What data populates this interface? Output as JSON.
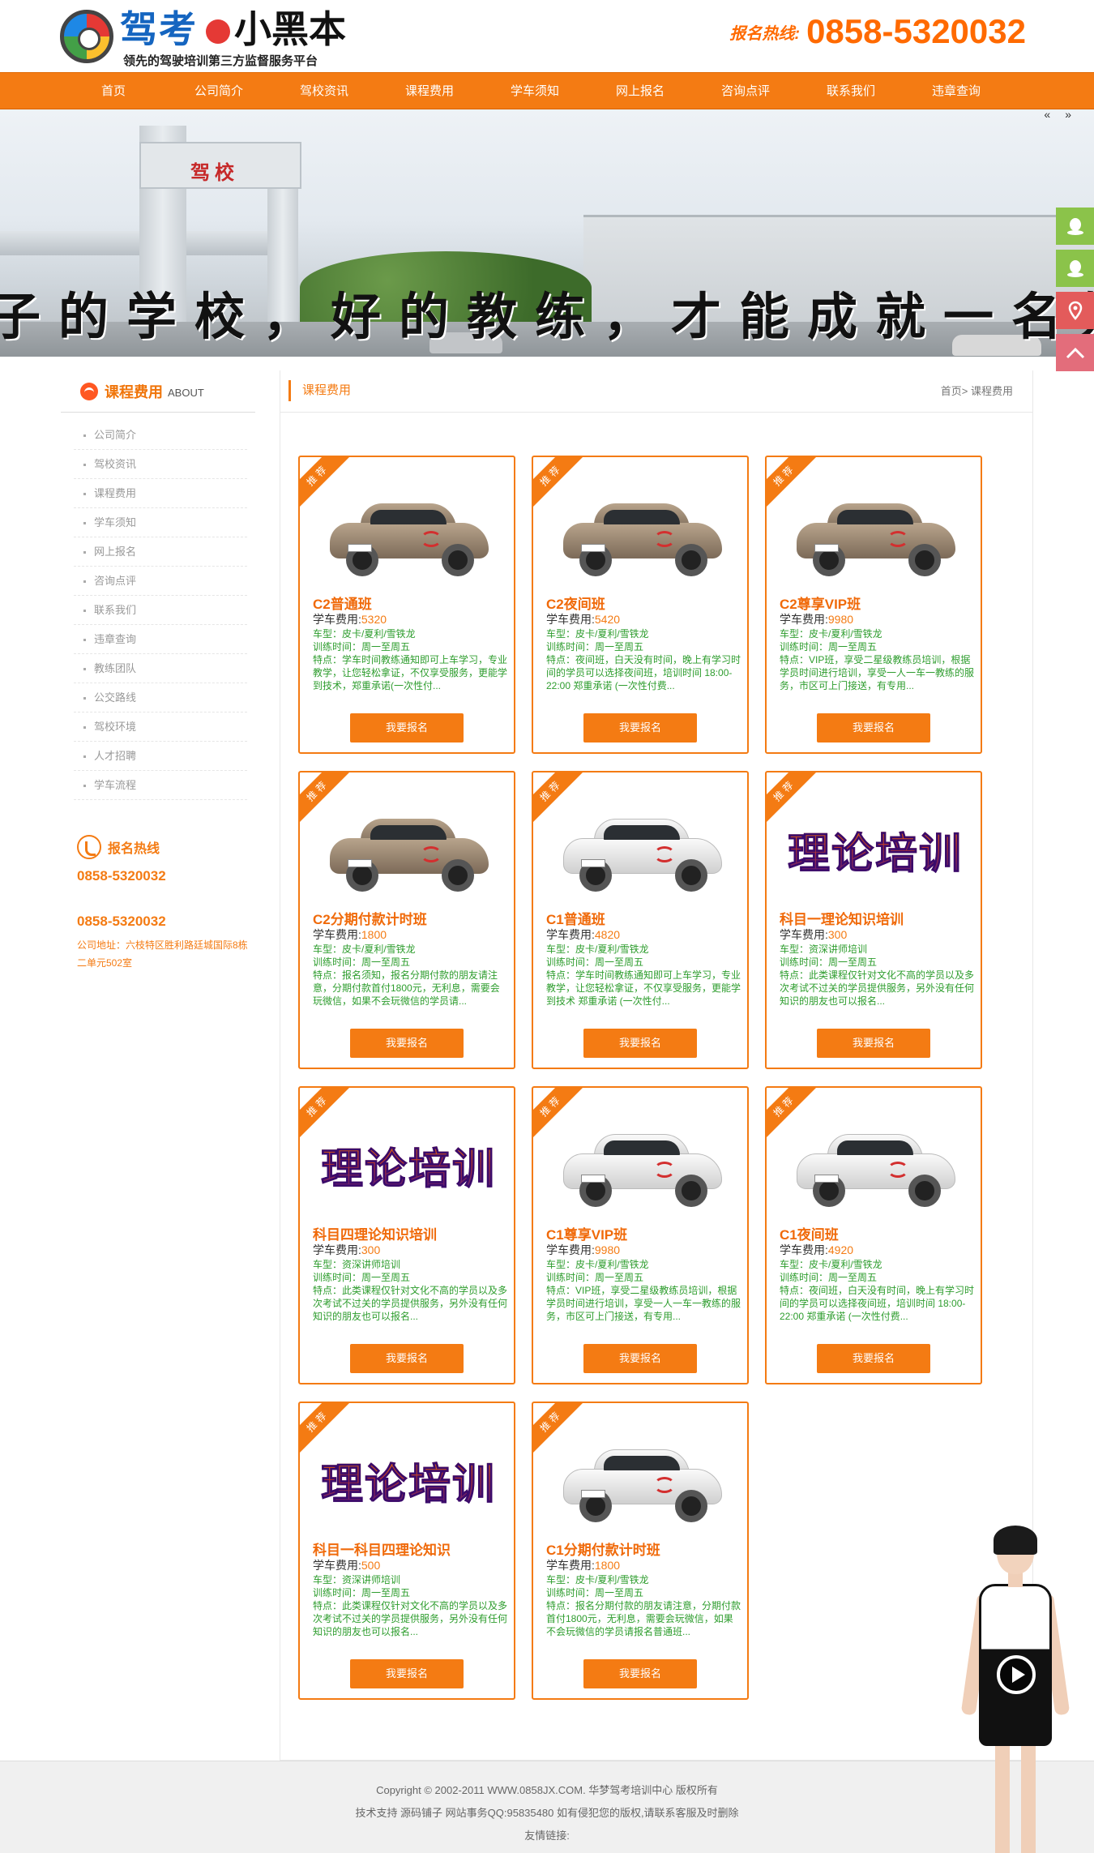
{
  "header": {
    "logo_text_1": "驾考",
    "logo_text_2": "小黑本",
    "logo_slogan": "领先的驾驶培训第三方监督服务平台",
    "hotline_label": "报名热线:",
    "hotline_number": "0858-5320032"
  },
  "nav": [
    "首页",
    "公司简介",
    "驾校资讯",
    "课程费用",
    "学车须知",
    "网上报名",
    "咨询点评",
    "联系我们",
    "违章查询"
  ],
  "banner": {
    "gate_sign": "驾校",
    "slogan": "子的学校，好的教练，才能成就一名好的司"
  },
  "sidebar": {
    "title": "课程费用",
    "title_sub": "ABOUT",
    "items": [
      "公司简介",
      "驾校资讯",
      "课程费用",
      "学车须知",
      "网上报名",
      "咨询点评",
      "联系我们",
      "违章查询",
      "教练团队",
      "公交路线",
      "驾校环境",
      "人才招聘",
      "学车流程"
    ],
    "contact_title": "报名热线",
    "phone_1": "0858-5320032",
    "phone_2": "0858-5320032",
    "address": "公司地址：六枝特区胜利路廷城国际8栋二单元502室"
  },
  "content": {
    "title": "课程费用",
    "breadcrumb": "首页> 课程费用"
  },
  "ribbon_label": "推荐",
  "fee_label": "学车费用:",
  "signup_label": "我要报名",
  "courses": [
    {
      "name": "C2普通班",
      "fee": "5320",
      "image": "brown-car",
      "car": "车型：皮卡/夏利/雪铁龙",
      "time": "训练时间：周一至周五",
      "desc": "特点：学车时间教练通知即可上车学习，专业教学，让您轻松拿证，不仅享受服务，更能学到技术，郑重承诺(一次性付..."
    },
    {
      "name": "C2夜间班",
      "fee": "5420",
      "image": "brown-car",
      "car": "车型：皮卡/夏利/雪铁龙",
      "time": "训练时间：周一至周五",
      "desc": "特点：夜间班，白天没有时间，晚上有学习时间的学员可以选择夜间班，培训时间 18:00-22:00 郑重承诺 (一次性付费..."
    },
    {
      "name": "C2尊享VIP班",
      "fee": "9980",
      "image": "brown-car",
      "car": "车型：皮卡/夏利/雪铁龙",
      "time": "训练时间：周一至周五",
      "desc": "特点：VIP班，享受二星级教练员培训，根据学员时间进行培训，享受一人一车一教练的服务，市区可上门接送，有专用..."
    },
    {
      "name": "C2分期付款计时班",
      "fee": "1800",
      "image": "brown-car",
      "car": "车型：皮卡/夏利/雪铁龙",
      "time": "训练时间：周一至周五",
      "desc": "特点：报名须知，报名分期付款的朋友请注意，分期付款首付1800元，无利息，需要会玩微信，如果不会玩微信的学员请..."
    },
    {
      "name": "C1普通班",
      "fee": "4820",
      "image": "white-car",
      "car": "车型：皮卡/夏利/雪铁龙",
      "time": "训练时间：周一至周五",
      "desc": "特点：学车时间教练通知即可上车学习，专业教学，让您轻松拿证，不仅享受服务，更能学到技术 郑重承诺 (一次性付..."
    },
    {
      "name": "科目一理论知识培训",
      "fee": "300",
      "image": "theory",
      "car": "车型：资深讲师培训",
      "time": "训练时间：周一至周五",
      "desc": "特点：此类课程仅针对文化不高的学员以及多次考试不过关的学员提供服务，另外没有任何知识的朋友也可以报名..."
    },
    {
      "name": "科目四理论知识培训",
      "fee": "300",
      "image": "theory",
      "car": "车型：资深讲师培训",
      "time": "训练时间：周一至周五",
      "desc": "特点：此类课程仅针对文化不高的学员以及多次考试不过关的学员提供服务，另外没有任何知识的朋友也可以报名..."
    },
    {
      "name": "C1尊享VIP班",
      "fee": "9980",
      "image": "white-car",
      "car": "车型：皮卡/夏利/雪铁龙",
      "time": "训练时间：周一至周五",
      "desc": "特点：VIP班，享受二星级教练员培训，根据学员时间进行培训，享受一人一车一教练的服务，市区可上门接送，有专用..."
    },
    {
      "name": "C1夜间班",
      "fee": "4920",
      "image": "white-car",
      "car": "车型：皮卡/夏利/雪铁龙",
      "time": "训练时间：周一至周五",
      "desc": "特点：夜间班，白天没有时间，晚上有学习时间的学员可以选择夜间班，培训时间 18:00-22:00 郑重承诺 (一次性付费..."
    },
    {
      "name": "科目一科目四理论知识",
      "fee": "500",
      "image": "theory",
      "car": "车型：资深讲师培训",
      "time": "训练时间：周一至周五",
      "desc": "特点：此类课程仅针对文化不高的学员以及多次考试不过关的学员提供服务，另外没有任何知识的朋友也可以报名..."
    },
    {
      "name": "C1分期付款计时班",
      "fee": "1800",
      "image": "white-car",
      "car": "车型：皮卡/夏利/雪铁龙",
      "time": "训练时间：周一至周五",
      "desc": "特点：报名分期付款的朋友请注意，分期付款首付1800元，无利息，需要会玩微信，如果不会玩微信的学员请报名普通班..."
    }
  ],
  "theory_text": "理论培训",
  "footer": {
    "line1": "Copyright © 2002-2011 WWW.0858JX.COM. 华梦驾考培训中心 版权所有",
    "line2": "技术支持 源码铺子 网站事务QQ:95835480 如有侵犯您的版权,请联系客服及时删除",
    "line3": "友情链接:"
  },
  "colors": {
    "accent": "#f47b13",
    "green_text": "#2e9d2e"
  },
  "float_icons": [
    "qq-icon",
    "qq-icon",
    "location-icon",
    "back-to-top-icon"
  ]
}
